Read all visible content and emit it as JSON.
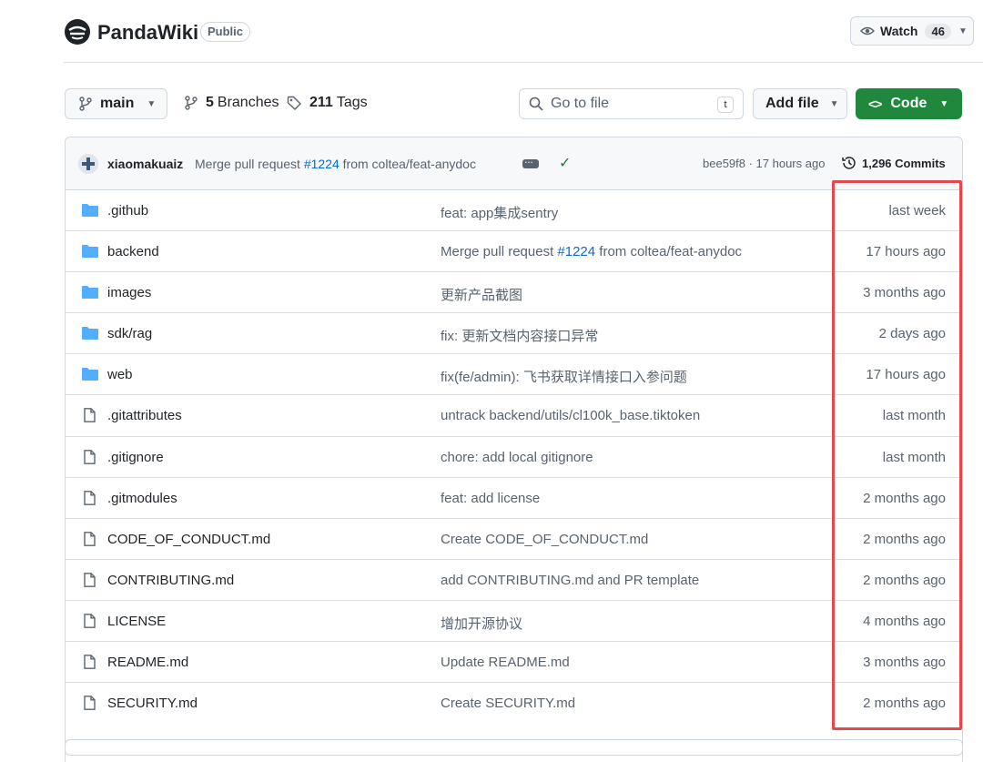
{
  "repo": {
    "name": "PandaWiki",
    "visibility": "Public",
    "watch_label": "Watch",
    "watch_count": "46"
  },
  "toolbar": {
    "branch": "main",
    "branches_count": "5",
    "branches_label": "Branches",
    "tags_count": "211",
    "tags_label": "Tags",
    "search_placeholder": "Go to file",
    "search_shortcut": "t",
    "add_file_label": "Add file",
    "code_label": "Code"
  },
  "latest_commit": {
    "author": "xiaomakuaiz",
    "message_prefix": "Merge pull request ",
    "pr": "#1224",
    "message_suffix": " from coltea/feat-anydoc",
    "hash_time": "bee59f8 · 17 hours ago",
    "commits_count": "1,296 Commits"
  },
  "files": [
    {
      "name": ".github",
      "type": "folder",
      "message": "feat: app集成sentry",
      "date": "last week"
    },
    {
      "name": "backend",
      "type": "folder",
      "message_prefix": "Merge pull request ",
      "pr": "#1224",
      "message_suffix": " from coltea/feat-anydoc",
      "date": "17 hours ago"
    },
    {
      "name": "images",
      "type": "folder",
      "message": "更新产品截图",
      "date": "3 months ago"
    },
    {
      "name": "sdk/rag",
      "type": "folder",
      "message": "fix: 更新文档内容接口异常",
      "date": "2 days ago"
    },
    {
      "name": "web",
      "type": "folder",
      "message": "fix(fe/admin): 飞书获取详情接口入参问题",
      "date": "17 hours ago"
    },
    {
      "name": ".gitattributes",
      "type": "file",
      "message": "untrack backend/utils/cl100k_base.tiktoken",
      "date": "last month"
    },
    {
      "name": ".gitignore",
      "type": "file",
      "message": "chore: add local gitignore",
      "date": "last month"
    },
    {
      "name": ".gitmodules",
      "type": "file",
      "message": "feat: add license",
      "date": "2 months ago"
    },
    {
      "name": "CODE_OF_CONDUCT.md",
      "type": "file",
      "message": "Create CODE_OF_CONDUCT.md",
      "date": "2 months ago"
    },
    {
      "name": "CONTRIBUTING.md",
      "type": "file",
      "message": "add CONTRIBUTING.md and PR template",
      "date": "2 months ago"
    },
    {
      "name": "LICENSE",
      "type": "file",
      "message": "增加开源协议",
      "date": "4 months ago"
    },
    {
      "name": "README.md",
      "type": "file",
      "message": "Update README.md",
      "date": "3 months ago"
    },
    {
      "name": "SECURITY.md",
      "type": "file",
      "message": "Create SECURITY.md",
      "date": "2 months ago"
    }
  ],
  "colors": {
    "accent_green": "#1f883d",
    "link_blue": "#0969da",
    "folder_blue": "#54aeff",
    "highlight_red": "#e5484d"
  },
  "icons": {
    "branch": "git-branch-icon",
    "tag": "tag-icon",
    "search": "search-icon",
    "folder": "folder-icon",
    "file": "file-icon",
    "history": "history-icon",
    "eye": "eye-icon",
    "check": "check-icon"
  }
}
